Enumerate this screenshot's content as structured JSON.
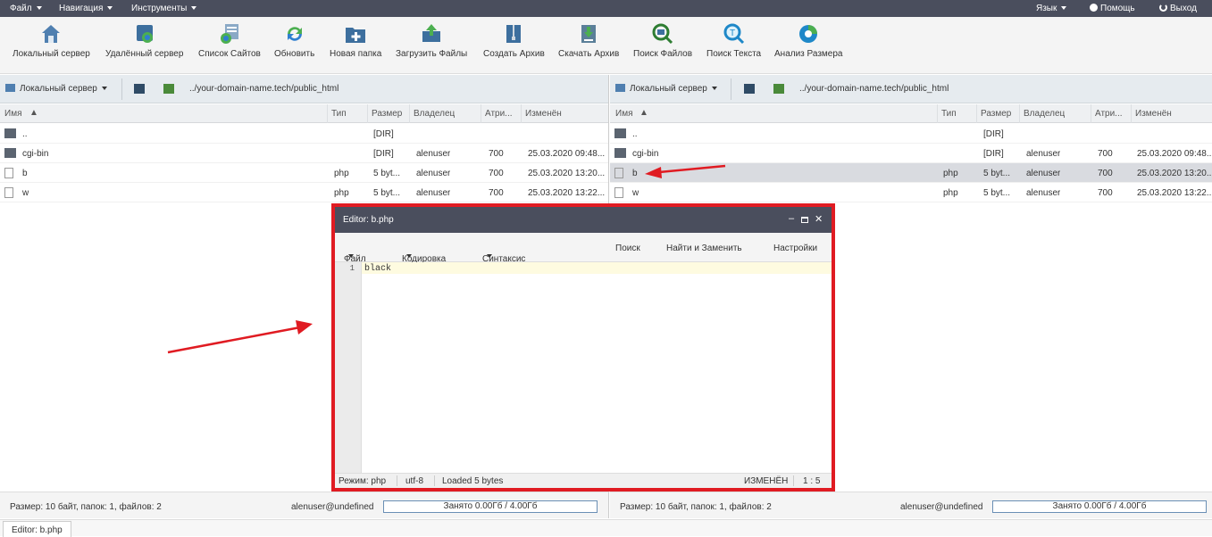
{
  "menubar": {
    "file": "Файл",
    "navigation": "Навигация",
    "tools": "Инструменты",
    "language": "Язык",
    "help": "Помощь",
    "exit": "Выход"
  },
  "toolbar": [
    {
      "label": "Локальный сервер",
      "icon": "home-server-icon"
    },
    {
      "label": "Удалённый сервер",
      "icon": "remote-server-icon"
    },
    {
      "label": "Список Сайтов",
      "icon": "sites-list-icon"
    },
    {
      "label": "Обновить",
      "icon": "refresh-icon"
    },
    {
      "label": "Новая папка",
      "icon": "new-folder-icon"
    },
    {
      "label": "Загрузить Файлы",
      "icon": "upload-icon"
    },
    {
      "label": "Создать Архив",
      "icon": "archive-icon"
    },
    {
      "label": "Скачать Архив",
      "icon": "download-archive-icon"
    },
    {
      "label": "Поиск Файлов",
      "icon": "file-search-icon"
    },
    {
      "label": "Поиск Текста",
      "icon": "text-search-icon"
    },
    {
      "label": "Анализ Размера",
      "icon": "size-analysis-icon"
    }
  ],
  "left_pane": {
    "server": "Локальный сервер",
    "path": "../your-domain-name.tech/public_html",
    "columns": [
      "Имя",
      "Тип",
      "Размер",
      "Владелец",
      "Атри...",
      "Изменён"
    ],
    "rows": [
      {
        "name": "..",
        "type": "",
        "size": "[DIR]",
        "owner": "",
        "attr": "",
        "modified": ""
      },
      {
        "name": "cgi-bin",
        "type": "",
        "size": "[DIR]",
        "owner": "alenuser",
        "attr": "700",
        "modified": "25.03.2020 09:48..."
      },
      {
        "name": "b",
        "type": "php",
        "size": "5 byt...",
        "owner": "alenuser",
        "attr": "700",
        "modified": "25.03.2020 13:20..."
      },
      {
        "name": "w",
        "type": "php",
        "size": "5 byt...",
        "owner": "alenuser",
        "attr": "700",
        "modified": "25.03.2020 13:22..."
      }
    ],
    "status": "Размер: 10 байт, папок: 1, файлов: 2",
    "user": "alenuser@undefined",
    "quota": "Занято 0.00Гб / 4.00Гб"
  },
  "right_pane": {
    "server": "Локальный сервер",
    "path": "../your-domain-name.tech/public_html",
    "columns": [
      "Имя",
      "Тип",
      "Размер",
      "Владелец",
      "Атри...",
      "Изменён"
    ],
    "rows": [
      {
        "name": "..",
        "type": "",
        "size": "[DIR]",
        "owner": "",
        "attr": "",
        "modified": ""
      },
      {
        "name": "cgi-bin",
        "type": "",
        "size": "[DIR]",
        "owner": "alenuser",
        "attr": "700",
        "modified": "25.03.2020 09:48..."
      },
      {
        "name": "b",
        "type": "php",
        "size": "5 byt...",
        "owner": "alenuser",
        "attr": "700",
        "modified": "25.03.2020 13:20..."
      },
      {
        "name": "w",
        "type": "php",
        "size": "5 byt...",
        "owner": "alenuser",
        "attr": "700",
        "modified": "25.03.2020 13:22..."
      }
    ],
    "status": "Размер: 10 байт, папок: 1, файлов: 2",
    "user": "alenuser@undefined",
    "quota": "Занято 0.00Гб / 4.00Гб"
  },
  "editor": {
    "title": "Editor: b.php",
    "menu": {
      "file": "Файл",
      "encoding": "Кодировка",
      "syntax": "Синтаксис",
      "search": "Поиск",
      "replace": "Найти и Заменить",
      "settings": "Настройки"
    },
    "line_number": "1",
    "code": "black",
    "status": {
      "mode": "Режим: php",
      "encoding": "utf-8",
      "loaded": "Loaded 5 bytes",
      "changed": "ИЗМЕНЁН",
      "position": "1 : 5"
    }
  },
  "taskbar": {
    "item": "Editor: b.php"
  },
  "colors": {
    "highlight_border": "#e01b22",
    "titlebar": "#4a4e5d",
    "selected_row": "#d9dbe0"
  }
}
